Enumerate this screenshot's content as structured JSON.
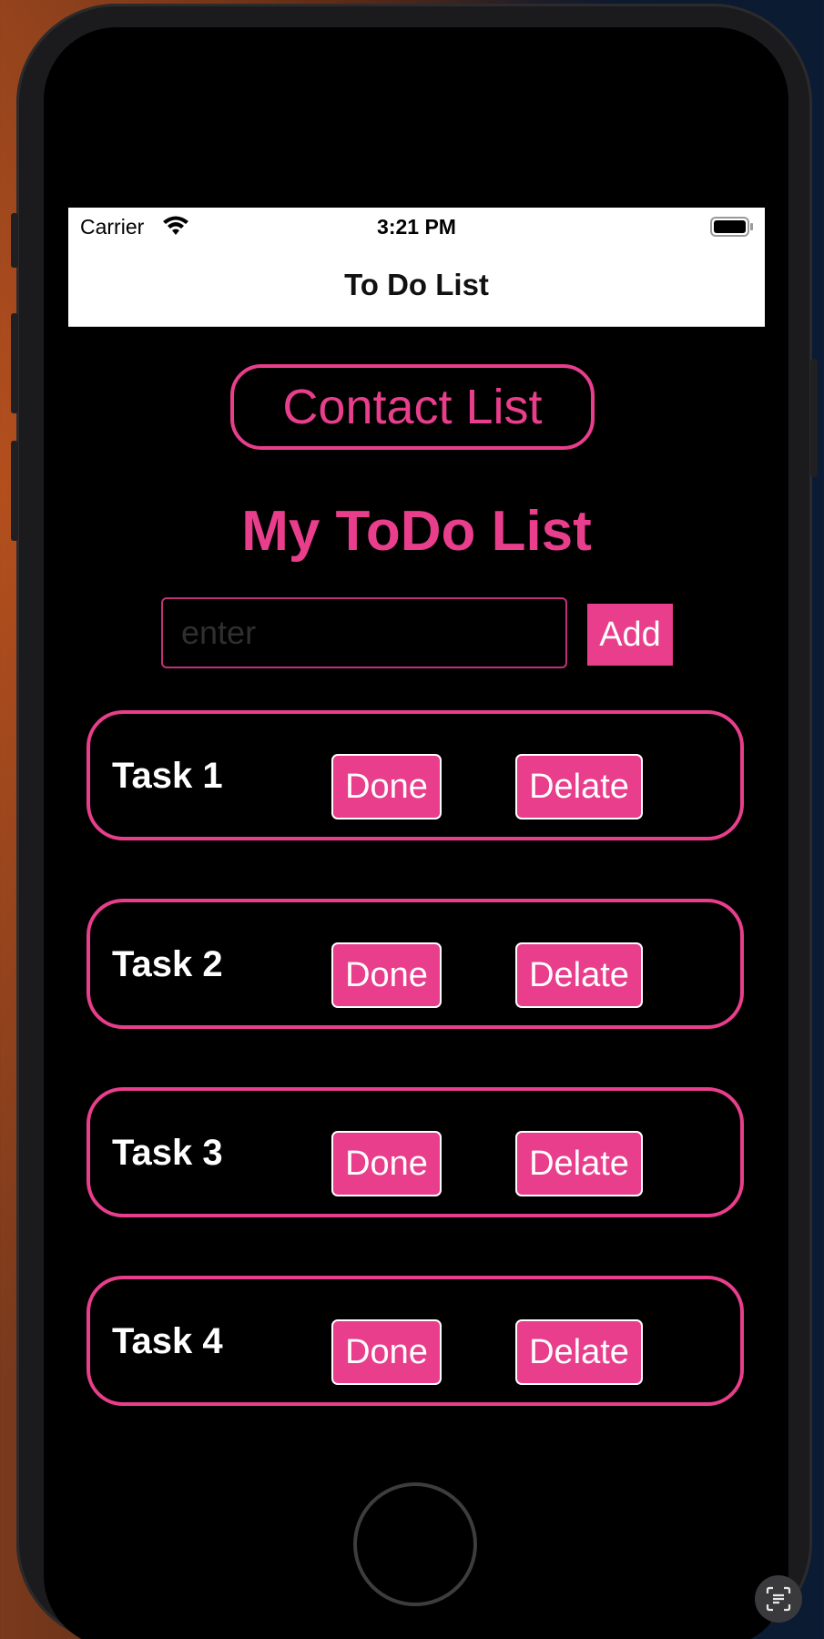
{
  "status_bar": {
    "carrier": "Carrier",
    "time": "3:21 PM",
    "wifi_icon": "wifi-icon",
    "battery_icon": "battery-icon"
  },
  "nav": {
    "title": "To Do List"
  },
  "contact_button": {
    "label": "Contact List"
  },
  "page_title": "My ToDo List",
  "input": {
    "placeholder": "enter",
    "value": ""
  },
  "add_button": {
    "label": "Add"
  },
  "tasks": [
    {
      "label": "Task 1",
      "done_label": "Done",
      "delete_label": "Delate"
    },
    {
      "label": "Task 2",
      "done_label": "Done",
      "delete_label": "Delate"
    },
    {
      "label": "Task 3",
      "done_label": "Done",
      "delete_label": "Delate"
    },
    {
      "label": "Task 4",
      "done_label": "Done",
      "delete_label": "Delate"
    }
  ],
  "colors": {
    "accent": "#e83e8c",
    "background": "#000000",
    "nav_background": "#ffffff"
  },
  "overlay": {
    "live_text_icon": "live-text-icon"
  }
}
